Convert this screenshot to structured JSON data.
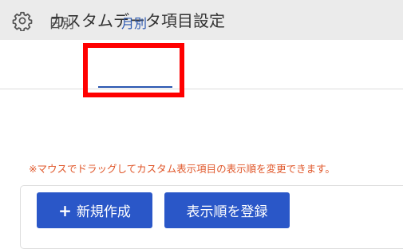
{
  "header": {
    "icon": "gear-icon",
    "title": "カスタムデータ項目設定"
  },
  "tabs": [
    {
      "label": "日別",
      "active": false
    },
    {
      "label": "月別",
      "active": true
    }
  ],
  "notice": "※マウスでドラッグしてカスタム表示項目の表示順を変更できます。",
  "buttons": {
    "new_icon": "plus-icon",
    "new_label": "新規作成",
    "order_label": "表示順を登録"
  },
  "colors": {
    "accent": "#2a57c8",
    "highlight": "#ff0000",
    "notice": "#e0572a",
    "header_bg": "#ebebeb"
  }
}
